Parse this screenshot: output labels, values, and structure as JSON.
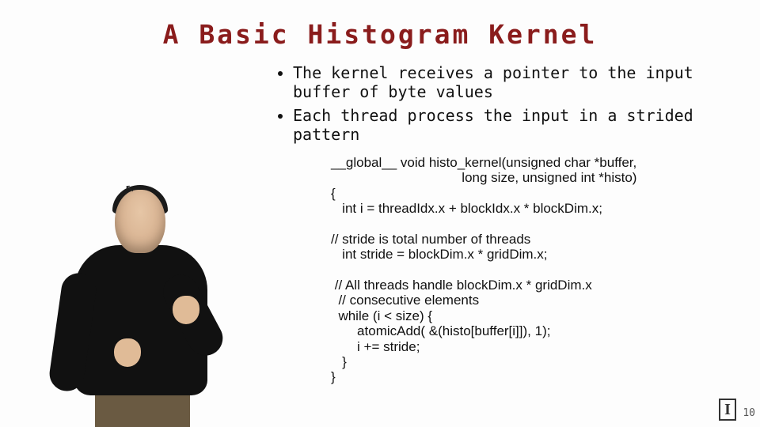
{
  "title": "A Basic Histogram Kernel",
  "bullets": {
    "b1": "The kernel receives a pointer to the input buffer of byte values",
    "b2": "Each thread process the input  in a strided pattern"
  },
  "code_text": "__global__ void histo_kernel(unsigned char *buffer,\n                                   long size, unsigned int *histo)\n{\n   int i = threadIdx.x + blockIdx.x * blockDim.x;\n\n// stride is total number of threads\n   int stride = blockDim.x * gridDim.x;\n\n // All threads handle blockDim.x * gridDim.x\n  // consecutive elements\n  while (i < size) {\n       atomicAdd( &(histo[buffer[i]]), 1);\n       i += stride;\n   }\n}",
  "logo_letter": "I",
  "page_number": "10"
}
